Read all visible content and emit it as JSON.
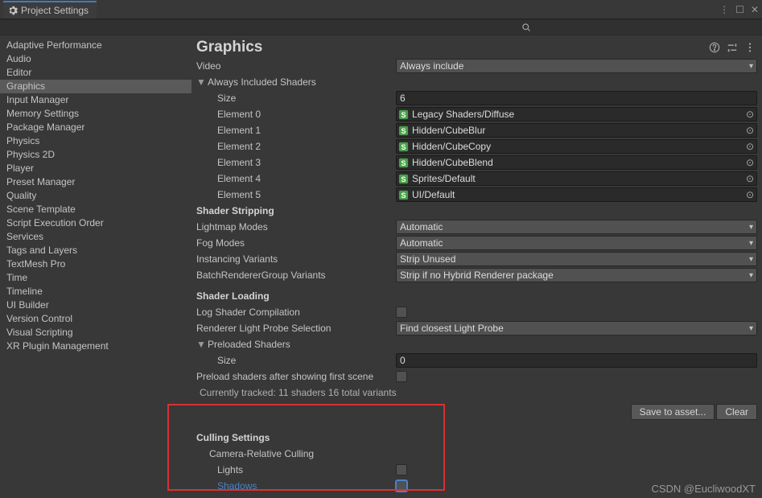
{
  "window": {
    "title": "Project Settings",
    "win_menu": "⋮",
    "win_max": "☐",
    "win_close": "✕"
  },
  "search": {
    "placeholder": ""
  },
  "sidebar": {
    "items": [
      "Adaptive Performance",
      "Audio",
      "Editor",
      "Graphics",
      "Input Manager",
      "Memory Settings",
      "Package Manager",
      "Physics",
      "Physics 2D",
      "Player",
      "Preset Manager",
      "Quality",
      "Scene Template",
      "Script Execution Order",
      "Services",
      "Tags and Layers",
      "TextMesh Pro",
      "Time",
      "Timeline",
      "UI Builder",
      "Version Control",
      "Visual Scripting",
      "XR Plugin Management"
    ],
    "selected_index": 3
  },
  "main": {
    "title": "Graphics",
    "video_label": "Video",
    "video_value": "Always include",
    "shaders_foldout": "Always Included Shaders",
    "size_label": "Size",
    "size_value": "6",
    "elements": [
      {
        "label": "Element 0",
        "value": "Legacy Shaders/Diffuse"
      },
      {
        "label": "Element 1",
        "value": "Hidden/CubeBlur"
      },
      {
        "label": "Element 2",
        "value": "Hidden/CubeCopy"
      },
      {
        "label": "Element 3",
        "value": "Hidden/CubeBlend"
      },
      {
        "label": "Element 4",
        "value": "Sprites/Default"
      },
      {
        "label": "Element 5",
        "value": "UI/Default"
      }
    ],
    "shader_stripping_header": "Shader Stripping",
    "lightmap_label": "Lightmap Modes",
    "lightmap_value": "Automatic",
    "fog_label": "Fog Modes",
    "fog_value": "Automatic",
    "instancing_label": "Instancing Variants",
    "instancing_value": "Strip Unused",
    "brg_label": "BatchRendererGroup Variants",
    "brg_value": "Strip if no Hybrid Renderer package",
    "shader_loading_header": "Shader Loading",
    "log_compilation_label": "Log Shader Compilation",
    "light_probe_label": "Renderer Light Probe Selection",
    "light_probe_value": "Find closest Light Probe",
    "preloaded_foldout": "Preloaded Shaders",
    "preloaded_size_label": "Size",
    "preloaded_size_value": "0",
    "preload_after_scene_label": "Preload shaders after showing first scene",
    "tracked_text": "Currently tracked: 11 shaders 16 total variants",
    "save_btn": "Save to asset...",
    "clear_btn": "Clear",
    "culling_header": "Culling Settings",
    "camera_relative_label": "Camera-Relative Culling",
    "lights_label": "Lights",
    "shadows_label": "Shadows"
  },
  "watermark": "CSDN @EucliwoodXT"
}
